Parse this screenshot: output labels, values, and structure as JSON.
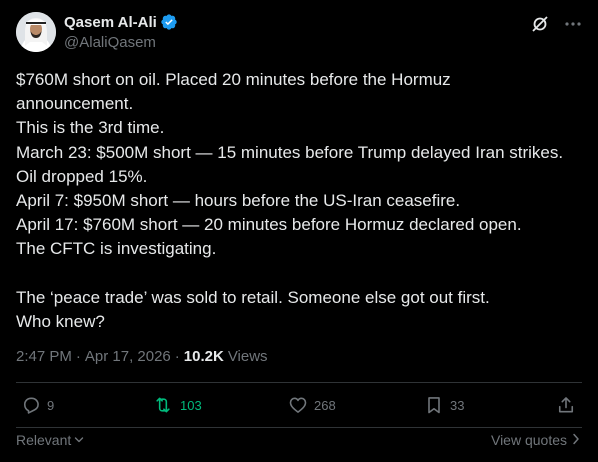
{
  "author": {
    "name": "Qasem Al-Ali",
    "handle": "@AlaliQasem",
    "verified_color": "#1d9bf0"
  },
  "icons": {
    "verified": "verified-badge-icon",
    "grok": "grok-icon",
    "more": "more-icon",
    "reply": "reply-icon",
    "repost": "repost-icon",
    "like": "heart-icon",
    "bookmark": "bookmark-icon",
    "share": "share-icon"
  },
  "post": {
    "lines": [
      "$760M short on oil. Placed 20 minutes before the Hormuz",
      "announcement.",
      "This is the 3rd time.",
      "March 23: $500M short — 15 minutes before Trump delayed Iran strikes.",
      "Oil dropped 15%.",
      "April 7: $950M short — hours before the US-Iran ceasefire.",
      "April 17: $760M short — 20 minutes before Hormuz declared open.",
      "The CFTC is investigating."
    ],
    "lines2": [
      "The ‘peace trade’ was sold to retail. Someone else got out first.",
      "Who knew?"
    ]
  },
  "meta": {
    "time": "2:47 PM",
    "separator": "·",
    "date": "Apr 17, 2026",
    "views_count": "10.2K",
    "views_label": "Views"
  },
  "actions": {
    "replies": "9",
    "reposts": "103",
    "likes": "268",
    "bookmarks": "33",
    "repost_color": "#00ba7c"
  },
  "footer": {
    "sort_label": "Relevant",
    "view_quotes_label": "View quotes"
  }
}
